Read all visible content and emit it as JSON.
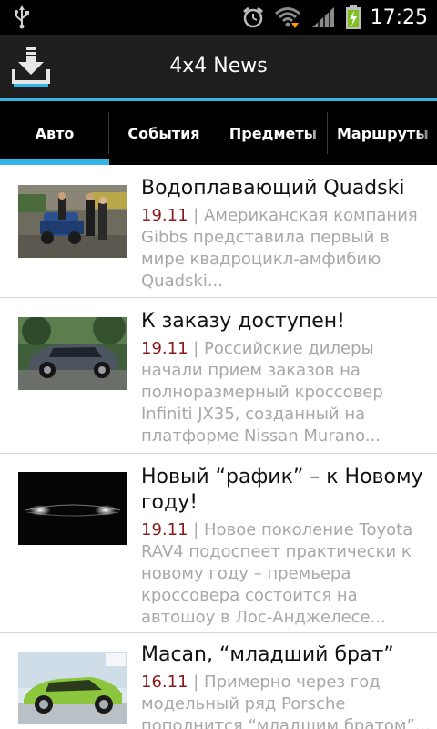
{
  "status_bar": {
    "time": "17:25",
    "icons": [
      "usb-icon",
      "alarm-icon",
      "wifi-icon",
      "signal-icon",
      "battery-charging-icon"
    ]
  },
  "action_bar": {
    "title": "4x4 News",
    "logo_icon": "download-icon"
  },
  "colors": {
    "accent": "#33b5e5",
    "date": "#8b1a1a",
    "description": "#a8a8a8"
  },
  "tabs": [
    {
      "label": "Авто",
      "active": true
    },
    {
      "label": "События",
      "active": false
    },
    {
      "label": "Предметы",
      "active": false
    },
    {
      "label": "Маршруты",
      "active": false
    }
  ],
  "news": [
    {
      "title": "Водоплавающий Quadski",
      "date": "19.11",
      "separator": " | ",
      "text": "Американская компания Gibbs представила первый в мире квадроцикл-амфибию Quadski..."
    },
    {
      "title": "К заказу доступен!",
      "date": "19.11",
      "separator": " | ",
      "text": "Российские дилеры начали прием заказов на полноразмерный кроссовер Infiniti JX35, созданный на платформе Nissan Murano..."
    },
    {
      "title": "Новый “рафик” – к Новому году!",
      "date": "19.11",
      "separator": " | ",
      "text": "Новое поколение Toyota RAV4 подоспеет практически к новому году – премьера кроссовера состоится на автошоу в Лос-Анджелесе..."
    },
    {
      "title": "Macan, “младший брат”",
      "date": "16.11",
      "separator": " | ",
      "text": "Примерно через год модельный ряд Porsche пополнится “младшим братом”..."
    }
  ]
}
